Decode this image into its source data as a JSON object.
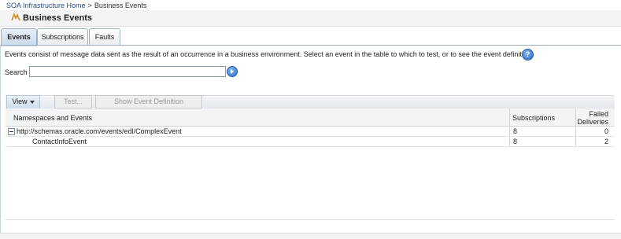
{
  "breadcrumb": {
    "home": "SOA Infrastructure Home",
    "separator": ">",
    "current": "Business Events"
  },
  "page_title": "Business Events",
  "tabs": [
    {
      "label": "Events",
      "active": true
    },
    {
      "label": "Subscriptions",
      "active": false
    },
    {
      "label": "Faults",
      "active": false
    }
  ],
  "description": "Events consist of message data sent as the result of an occurrence in a business environment. Select an event in the table to which to test, or to see the event definition.",
  "help_glyph": "?",
  "search": {
    "label": "Search",
    "value": ""
  },
  "toolbar": {
    "view_label": "View",
    "test_label": "Test...",
    "show_def_label": "Show Event Definition"
  },
  "table": {
    "columns": [
      "Namespaces and Events",
      "Subscriptions",
      "Failed",
      "Deliveries"
    ],
    "rows": [
      {
        "name": "http://schemas.oracle.com/events/edl/ComplexEvent",
        "subscriptions": "8",
        "failed": "0",
        "expanded": true
      },
      {
        "name": "ContactInfoEvent",
        "subscriptions": "8",
        "failed": "2"
      }
    ]
  },
  "colors": {
    "link": "#2a4f86",
    "tab_border": "#9fb0c4",
    "help": "#2d6ac6"
  }
}
